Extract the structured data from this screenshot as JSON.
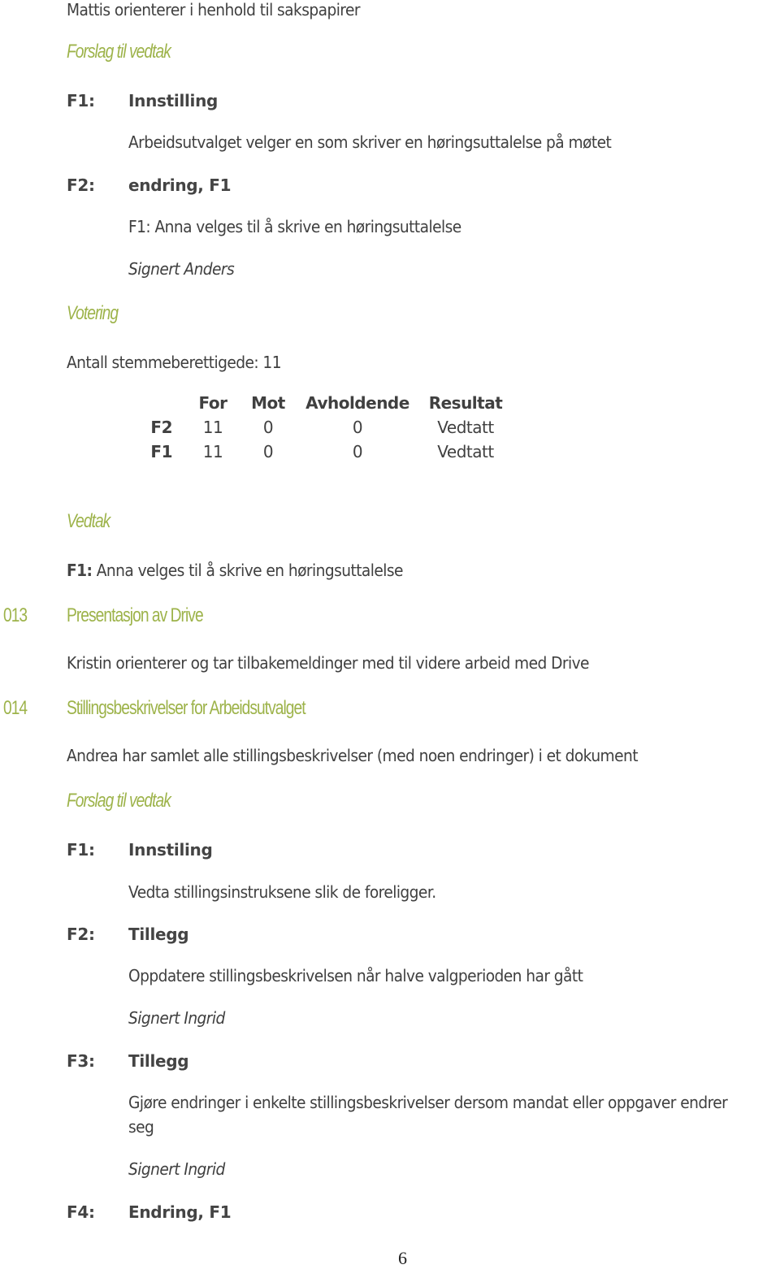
{
  "colors": {
    "accent": "#9db34a",
    "text": "#404040"
  },
  "intro_line": "Mattis orienterer i henhold til sakspapirer",
  "section1": {
    "heading": "Forslag til vedtak",
    "proposals": [
      {
        "label": "F1:",
        "title": "Innstilling",
        "text": "Arbeidsutvalget velger en som skriver en høringsuttalelse på møtet"
      },
      {
        "label": "F2:",
        "title": "endring, F1",
        "text": "F1: Anna velges til å skrive en høringsuttalelse",
        "signed": "Signert Anders"
      }
    ]
  },
  "voting": {
    "heading": "Votering",
    "eligible": "Antall stemmeberettigede: 11",
    "headers": [
      "For",
      "Mot",
      "Avholdende",
      "Resultat"
    ],
    "rows": [
      {
        "id": "F2",
        "for": "11",
        "mot": "0",
        "avholdende": "0",
        "resultat": "Vedtatt"
      },
      {
        "id": "F1",
        "for": "11",
        "mot": "0",
        "avholdende": "0",
        "resultat": "Vedtatt"
      }
    ]
  },
  "decision": {
    "heading": "Vedtak",
    "label": "F1:",
    "text": " Anna velges til å skrive en høringsuttalelse"
  },
  "item013": {
    "number": "013",
    "title": "Presentasjon av Drive",
    "text": "Kristin orienterer og tar tilbakemeldinger med til videre arbeid med Drive"
  },
  "item014": {
    "number": "014",
    "title": "Stillingsbeskrivelser for Arbeidsutvalget",
    "text": "Andrea har samlet alle stillingsbeskrivelser (med noen endringer) i et dokument",
    "proposals_heading": "Forslag til vedtak",
    "proposals": [
      {
        "label": "F1:",
        "title": "Innstiling",
        "text": "Vedta stillingsinstruksene slik de foreligger."
      },
      {
        "label": "F2:",
        "title": "Tillegg",
        "text": "Oppdatere stillingsbeskrivelsen når halve valgperioden har gått",
        "signed": "Signert Ingrid"
      },
      {
        "label": "F3:",
        "title": "Tillegg",
        "text_line1": "Gjøre endringer i enkelte stillingsbeskrivelser dersom mandat eller oppgaver endrer",
        "text_line2": "seg",
        "signed": "Signert Ingrid"
      },
      {
        "label": "F4:",
        "title": "Endring, F1"
      }
    ]
  },
  "page_number": "6"
}
